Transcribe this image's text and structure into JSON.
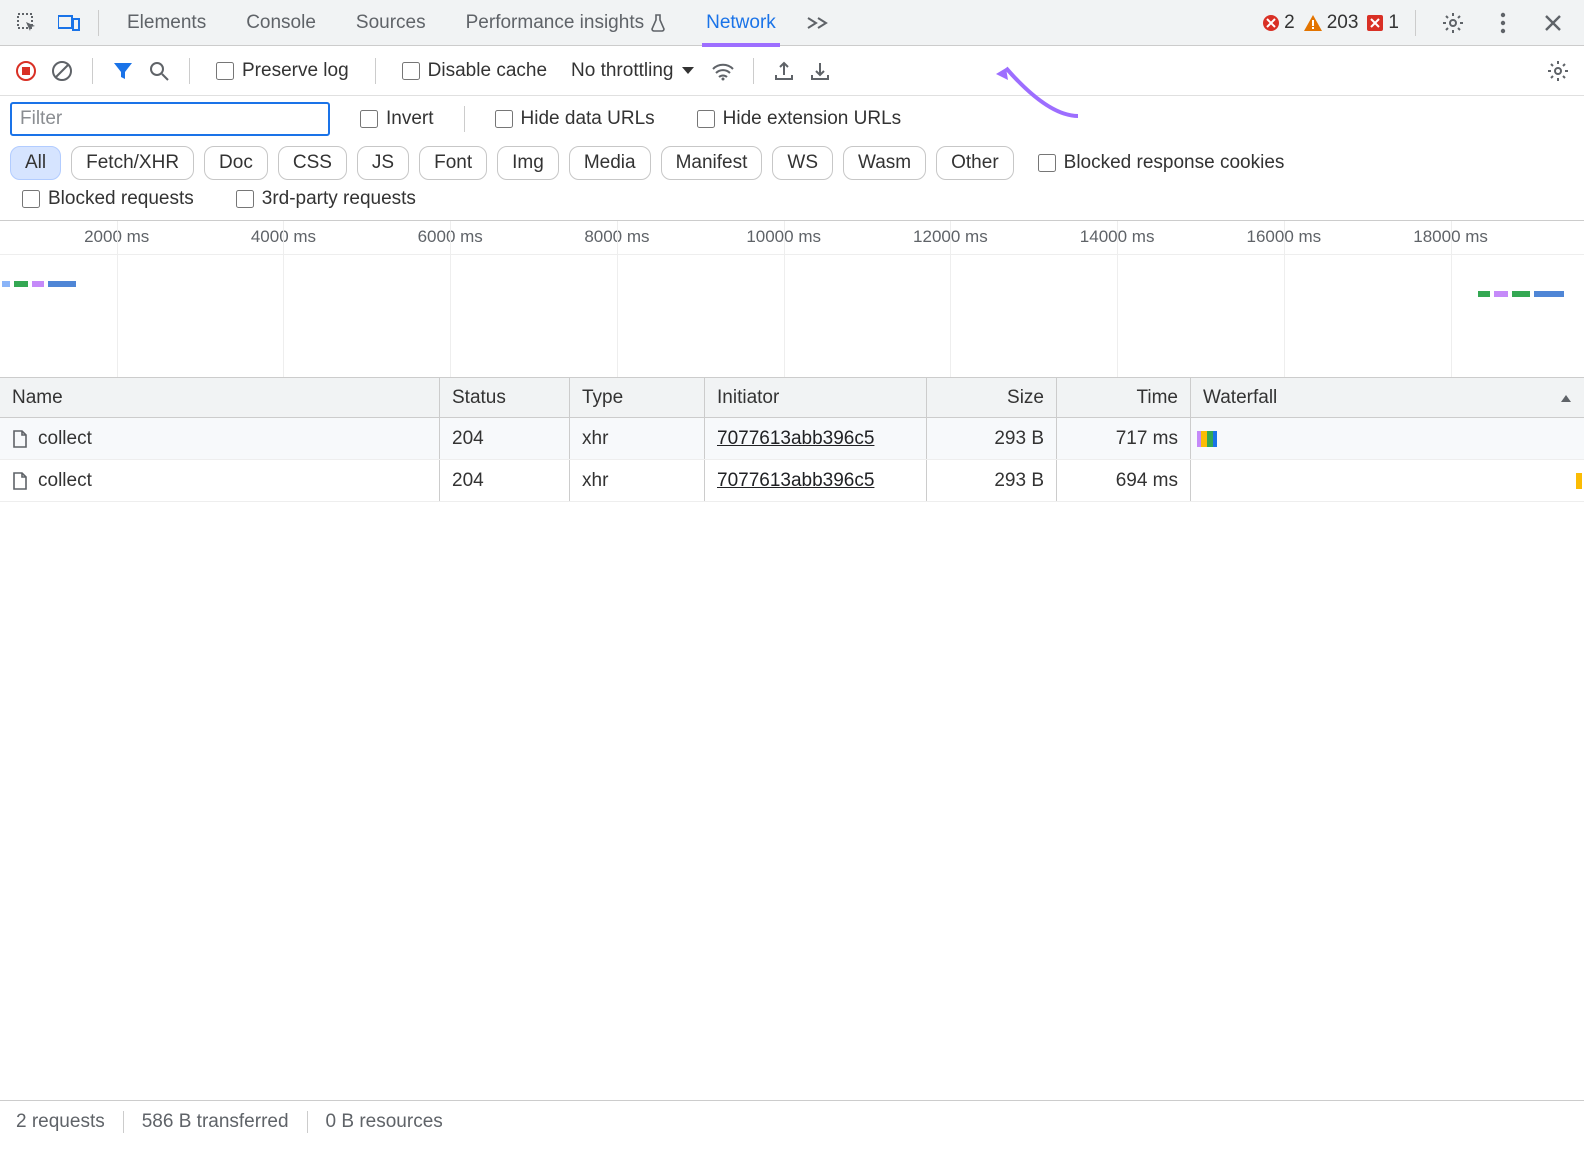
{
  "tabs": {
    "items": [
      "Elements",
      "Console",
      "Sources",
      "Performance insights",
      "Network"
    ],
    "active_index": 4
  },
  "indicators": {
    "errors": "2",
    "warnings": "203",
    "issues": "1"
  },
  "toolbar": {
    "preserve_log": "Preserve log",
    "disable_cache": "Disable cache",
    "throttling": "No throttling"
  },
  "filter": {
    "placeholder": "Filter",
    "invert": "Invert",
    "hide_data_urls": "Hide data URLs",
    "hide_ext_urls": "Hide extension URLs"
  },
  "chips": [
    "All",
    "Fetch/XHR",
    "Doc",
    "CSS",
    "JS",
    "Font",
    "Img",
    "Media",
    "Manifest",
    "WS",
    "Wasm",
    "Other"
  ],
  "chips_active_index": 0,
  "chip_checks": {
    "blocked_cookies": "Blocked response cookies",
    "blocked_requests": "Blocked requests",
    "third_party": "3rd-party requests"
  },
  "timeline": {
    "ticks": [
      "2000 ms",
      "4000 ms",
      "6000 ms",
      "8000 ms",
      "10000 ms",
      "12000 ms",
      "14000 ms",
      "16000 ms",
      "18000 ms"
    ]
  },
  "columns": {
    "name": "Name",
    "status": "Status",
    "type": "Type",
    "initiator": "Initiator",
    "size": "Size",
    "time": "Time",
    "waterfall": "Waterfall"
  },
  "rows": [
    {
      "name": "collect",
      "status": "204",
      "type": "xhr",
      "initiator": "7077613abb396c5",
      "size": "293 B",
      "time": "717 ms"
    },
    {
      "name": "collect",
      "status": "204",
      "type": "xhr",
      "initiator": "7077613abb396c5",
      "size": "293 B",
      "time": "694 ms"
    }
  ],
  "status": {
    "requests": "2 requests",
    "transferred": "586 B transferred",
    "resources": "0 B resources"
  }
}
